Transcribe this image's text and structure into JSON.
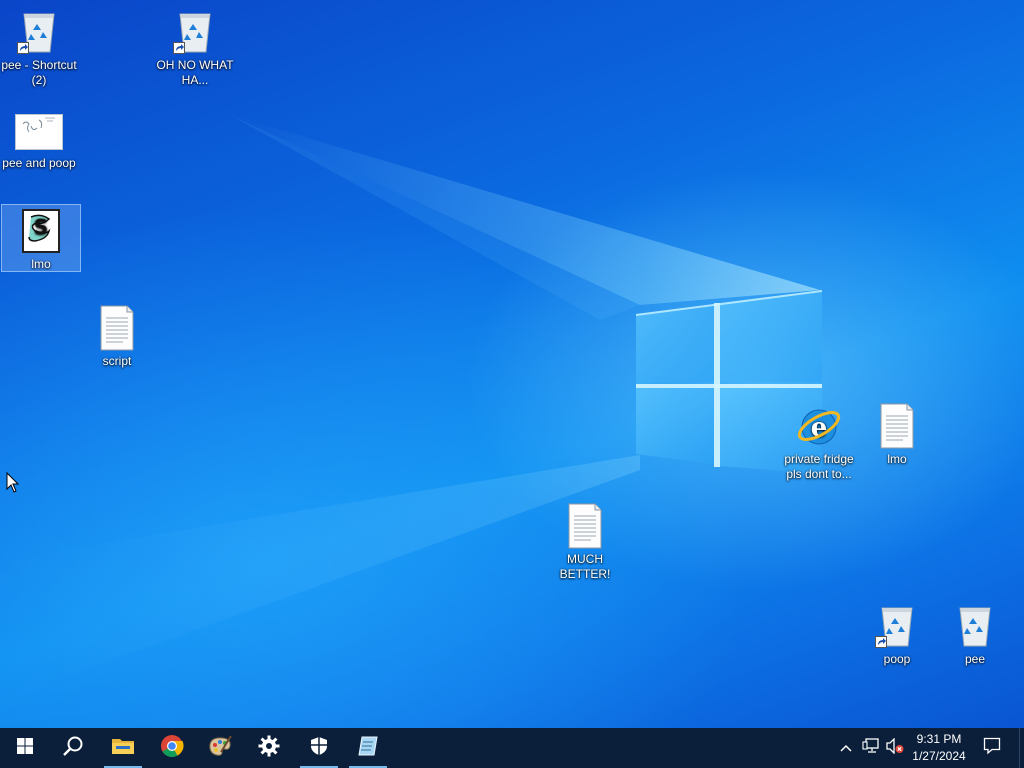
{
  "desktop": {
    "icons": [
      {
        "id": "pee-shortcut-2",
        "label": "pee - Shortcut (2)",
        "type": "recycle-bin-icon",
        "shortcut": true,
        "selected": false
      },
      {
        "id": "oh-no",
        "label": "OH NO WHAT HA...",
        "type": "recycle-bin-icon",
        "shortcut": true,
        "selected": false
      },
      {
        "id": "pee-and-poop",
        "label": "pee and poop",
        "type": "image-thumbnail-icon",
        "shortcut": false,
        "selected": false
      },
      {
        "id": "lmo-script",
        "label": "lmo",
        "type": "script-file-icon",
        "shortcut": false,
        "selected": true
      },
      {
        "id": "script",
        "label": "script",
        "type": "text-document-icon",
        "shortcut": false,
        "selected": false
      },
      {
        "id": "private-fridge",
        "label": "private fridge pls dont to...",
        "type": "internet-explorer-icon",
        "shortcut": false,
        "selected": false
      },
      {
        "id": "lmo-text",
        "label": "lmo",
        "type": "text-document-icon",
        "shortcut": false,
        "selected": false
      },
      {
        "id": "much-better",
        "label": "MUCH BETTER!",
        "type": "text-document-icon",
        "shortcut": false,
        "selected": false
      },
      {
        "id": "poop",
        "label": "poop",
        "type": "recycle-bin-icon",
        "shortcut": true,
        "selected": false
      },
      {
        "id": "pee",
        "label": "pee",
        "type": "recycle-bin-icon",
        "shortcut": false,
        "selected": false
      }
    ]
  },
  "taskbar": {
    "buttons": [
      {
        "id": "start",
        "icon": "windows-start-icon",
        "running": false
      },
      {
        "id": "search",
        "icon": "search-icon",
        "running": false
      },
      {
        "id": "file-explorer",
        "icon": "folder-icon",
        "running": true
      },
      {
        "id": "chrome",
        "icon": "chrome-icon",
        "running": false
      },
      {
        "id": "paint",
        "icon": "paint-palette-icon",
        "running": false
      },
      {
        "id": "settings",
        "icon": "gear-icon",
        "running": false
      },
      {
        "id": "security",
        "icon": "shield-icon",
        "running": true
      },
      {
        "id": "notepad-app",
        "icon": "notepad-icon",
        "running": true
      }
    ],
    "tray": {
      "chevron": "chevron-up-icon",
      "network": "network-icon",
      "volume": "volume-muted-icon",
      "notifications": "action-center-icon"
    },
    "clock": {
      "time": "9:31 PM",
      "date": "1/27/2024"
    }
  },
  "colors": {
    "taskbar_bg": "#0b1f3a",
    "running_indicator": "#76b9ed",
    "desktop_blue": "#0b6ae0"
  }
}
